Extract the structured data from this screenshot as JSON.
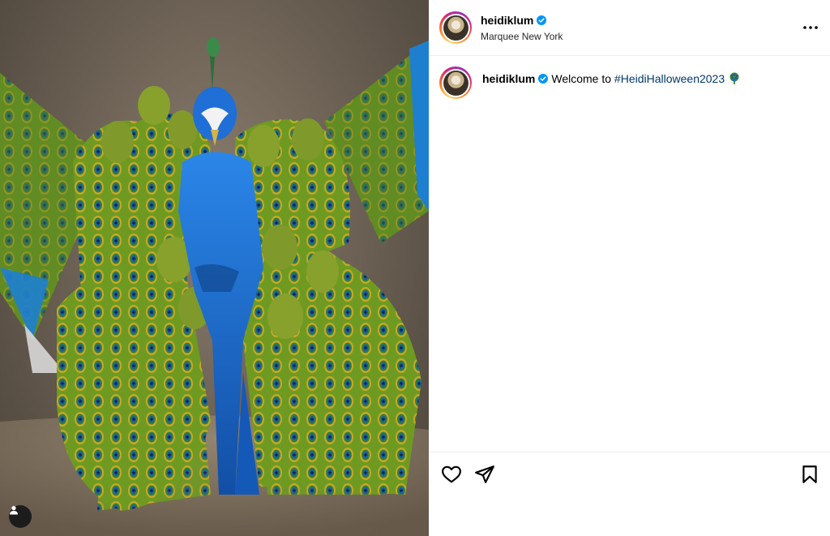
{
  "post": {
    "image_alt": "Group of performers in peacock body paint around a central figure in a blue peacock costume",
    "user_tag_icon": "user-tag-icon"
  },
  "header": {
    "username": "heidiklum",
    "location": "Marquee New York",
    "verified_icon": "verified-badge-icon",
    "more_icon": "more-options-icon"
  },
  "caption": {
    "username": "heidiklum",
    "text": "Welcome to",
    "hashtag": "#HeidiHalloween2023",
    "emoji_icon": "peacock-emoji-icon"
  },
  "actions": {
    "like_icon": "heart-icon",
    "share_icon": "paper-plane-icon",
    "save_icon": "bookmark-icon"
  },
  "colors": {
    "hashtag": "#00376b",
    "verified": "#0095f6",
    "divider": "#efefef",
    "costume_blue": "#1f6fd6",
    "paint_green": "#5f8a1f"
  }
}
